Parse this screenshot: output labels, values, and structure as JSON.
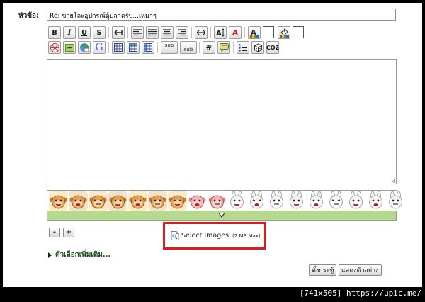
{
  "subject": {
    "label": "หัวข้อ:",
    "value": "Re: ขายโละอุปกรณ์ตู้ปลาครับ...เหมาๆ"
  },
  "toolbar": {
    "bold": "B",
    "italic": "I",
    "underline": "U",
    "strike": "S",
    "superscript": "sup",
    "subscript": "sub",
    "code": "#",
    "co2": "CO2",
    "google": "G",
    "font_face": "A",
    "font_color": "A"
  },
  "smileys": [
    "monkey-1",
    "monkey-2",
    "monkey-3",
    "monkey-4",
    "monkey-5",
    "monkey-6",
    "monkey-7",
    "pig-1",
    "pig-2",
    "bunny-1",
    "bunny-2",
    "bunny-3",
    "bunny-4",
    "bunny-5",
    "bunny-6",
    "bunny-7",
    "bunny-8",
    "bunny-9"
  ],
  "zoom": {
    "minus": "-",
    "plus": "+"
  },
  "upload": {
    "label": "Select Images",
    "limit": "(2 MB Max)"
  },
  "more_options": "ตัวเลือกเพิ่มเติม...",
  "actions": {
    "post": "ตั้งกระทู้",
    "preview": "แสดงตัวอย่าง"
  },
  "watermark": "[741x505] https://upic.me/"
}
